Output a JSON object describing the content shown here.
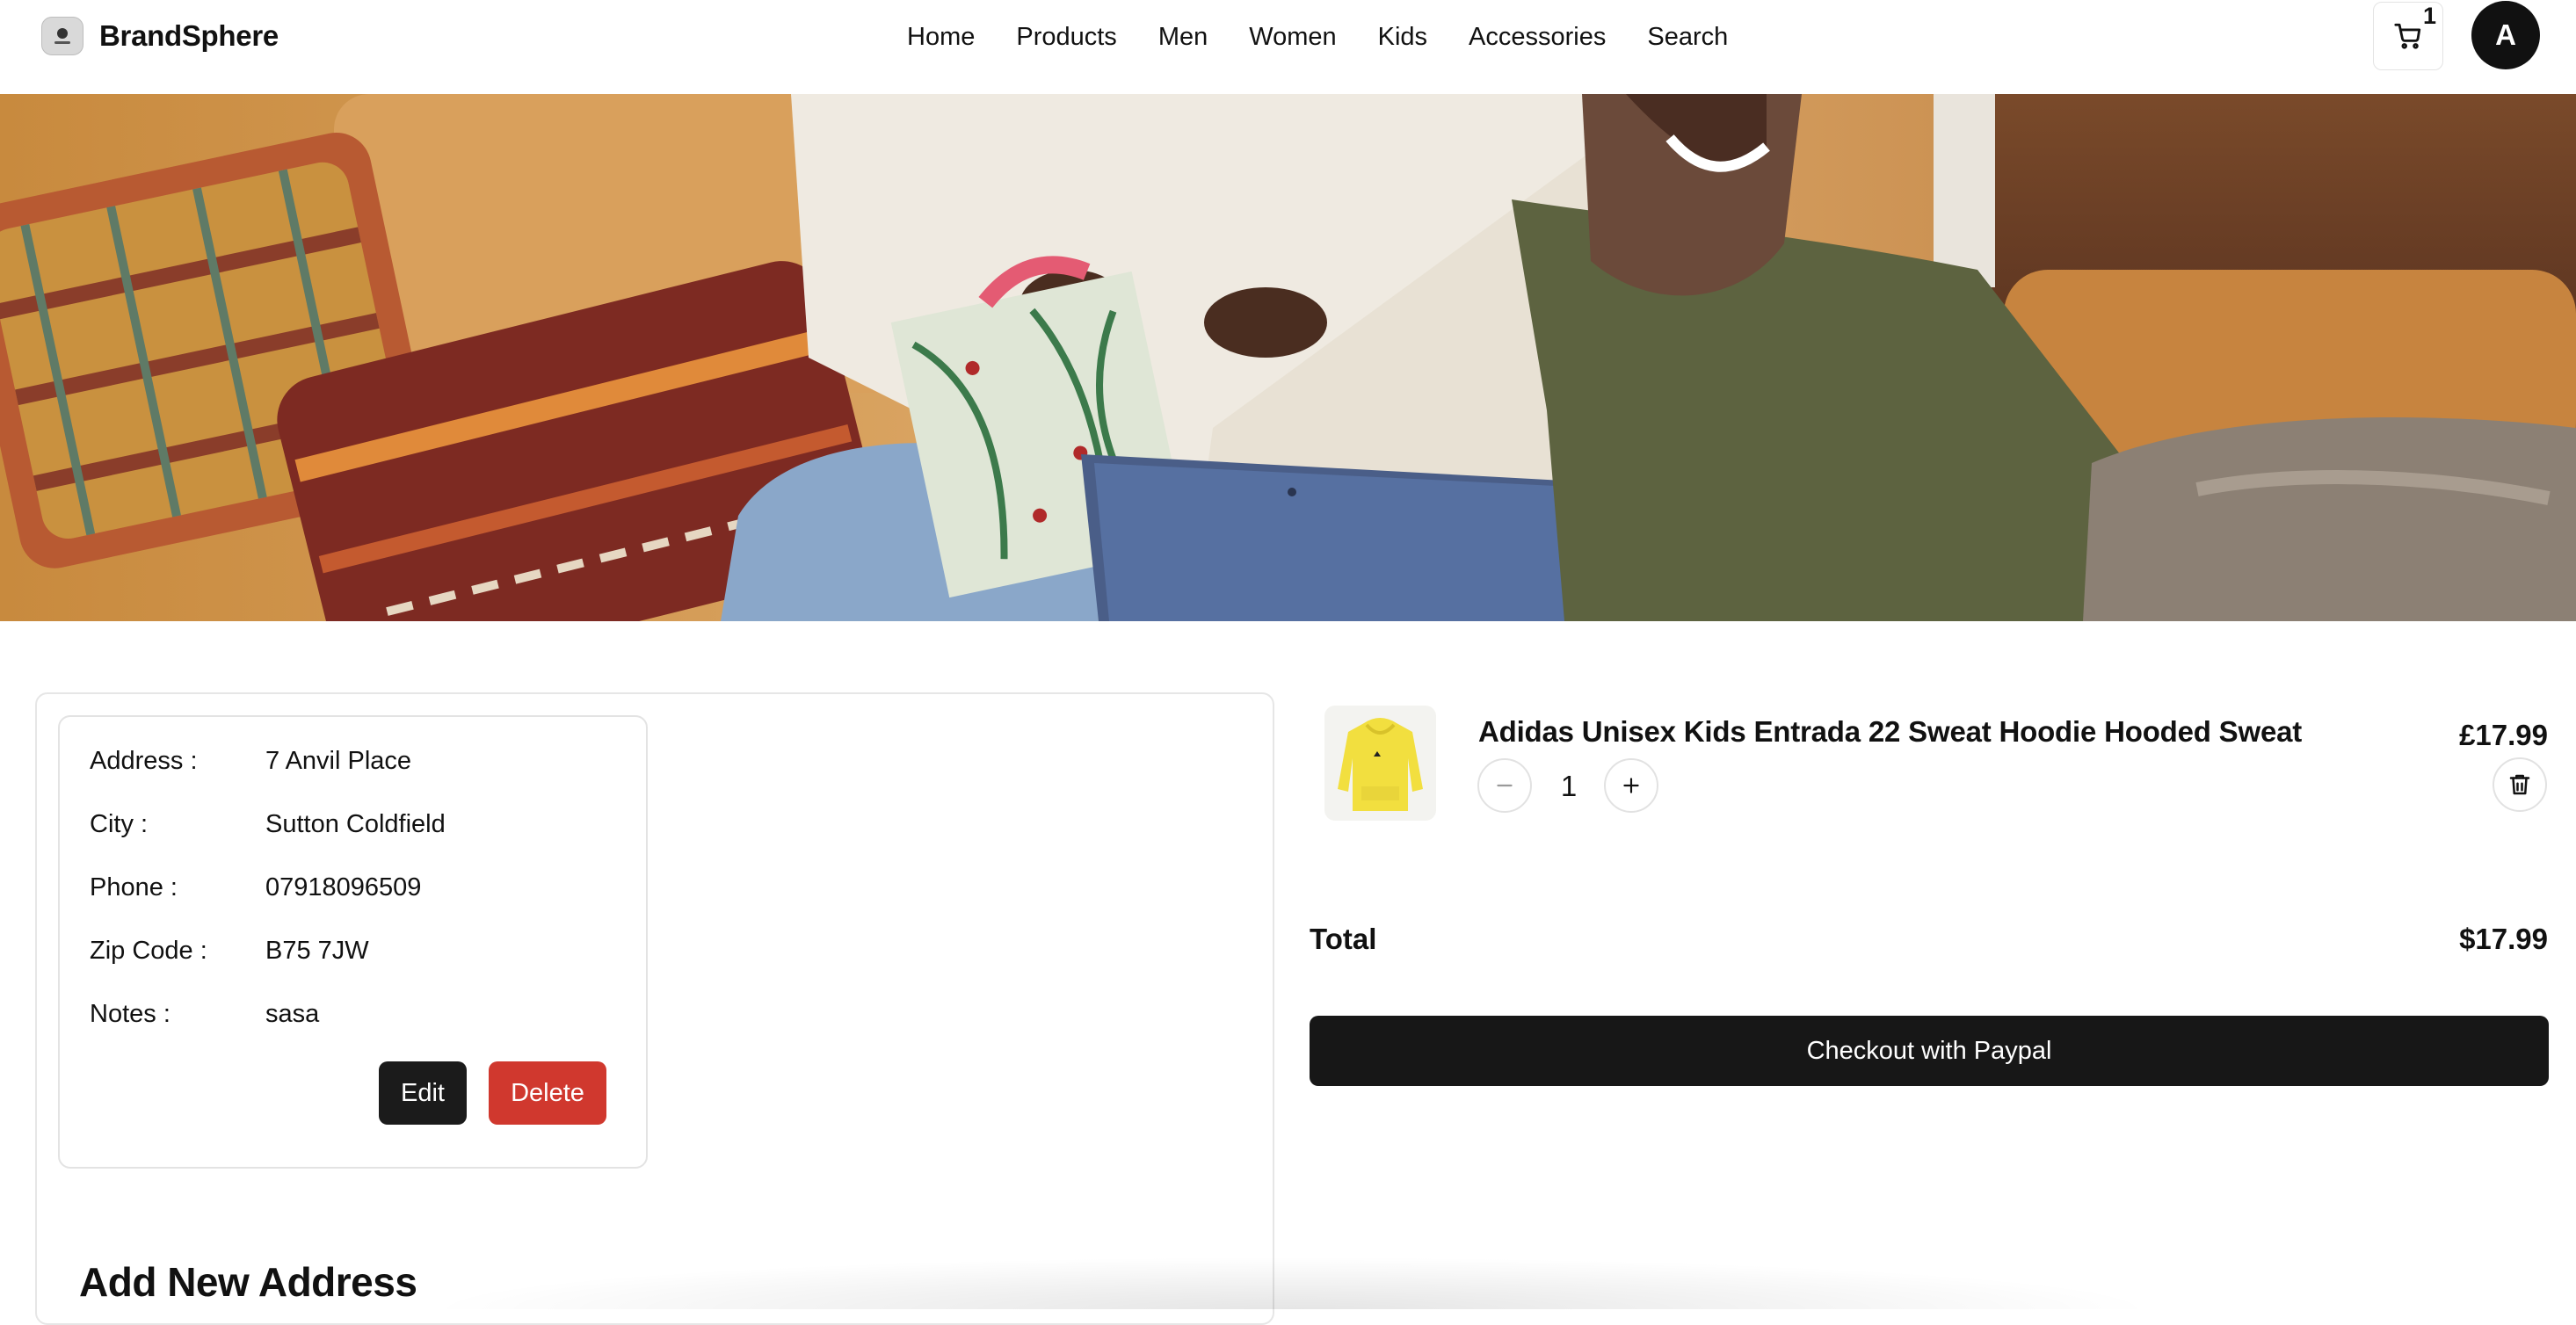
{
  "header": {
    "brand_name": "BrandSphere",
    "nav": [
      "Home",
      "Products",
      "Men",
      "Women",
      "Kids",
      "Accessories",
      "Search"
    ],
    "cart_count": "1",
    "avatar_initial": "A"
  },
  "hero": {
    "icon": "hero-photo"
  },
  "address": {
    "rows": [
      {
        "label": "Address :",
        "value": "7 Anvil Place"
      },
      {
        "label": "City :",
        "value": "Sutton Coldfield"
      },
      {
        "label": "Phone :",
        "value": "07918096509"
      },
      {
        "label": "Zip Code :",
        "value": "B75 7JW"
      },
      {
        "label": "Notes :",
        "value": "sasa"
      }
    ],
    "edit_label": "Edit",
    "delete_label": "Delete",
    "add_new_title": "Add New Address"
  },
  "cart": {
    "item": {
      "name": "Adidas Unisex Kids Entrada 22 Sweat Hoodie Hooded Sweat",
      "price": "£17.99",
      "quantity": "1"
    },
    "total_label": "Total",
    "total_value": "$17.99",
    "checkout_label": "Checkout with Paypal"
  },
  "colors": {
    "primary": "#171717",
    "danger": "#d0382e",
    "border": "#e3e3e3"
  }
}
